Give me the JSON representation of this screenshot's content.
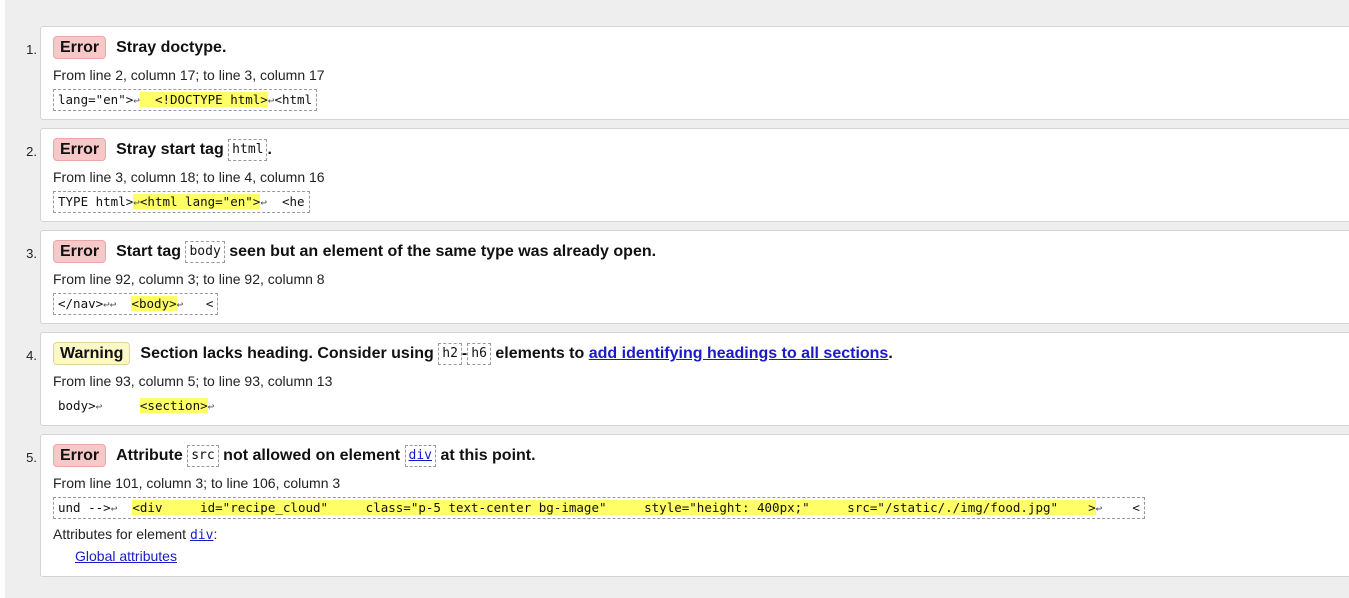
{
  "messages": [
    {
      "number": "1.",
      "type": "Error",
      "text_parts": [
        "Stray doctype."
      ],
      "location": "From line 2, column 17; to line 3, column 17",
      "extract": {
        "before": "lang=\"en\">",
        "hl": "  <!DOCTYPE html>",
        "after": "<html"
      }
    },
    {
      "number": "2.",
      "type": "Error",
      "text_a": "Stray start tag",
      "code": "html",
      "text_b": ".",
      "location": "From line 3, column 18; to line 4, column 16",
      "extract": {
        "before": "TYPE html>",
        "hl": "<html lang=\"en\">",
        "after": "  <he"
      }
    },
    {
      "number": "3.",
      "type": "Error",
      "text_a": "Start tag",
      "code": "body",
      "text_b": "seen but an element of the same type was already open.",
      "location": "From line 92, column 3; to line 92, column 8",
      "extract": {
        "before": "</nav>",
        "hl": "<body>",
        "after": "   <"
      }
    },
    {
      "number": "4.",
      "type": "Warning",
      "text_a": "Section lacks heading. Consider using",
      "code1": "h2",
      "dash": "-",
      "code2": "h6",
      "text_b": "elements to",
      "link": "add identifying headings to all sections",
      "text_c": ".",
      "location": "From line 93, column 5; to line 93, column 13",
      "extract": {
        "before": "body>",
        "hl": "<section>",
        "after": ""
      }
    },
    {
      "number": "5.",
      "type": "Error",
      "text_a": "Attribute",
      "code1": "src",
      "text_b": "not allowed on element",
      "code2": "div",
      "text_c": "at this point.",
      "location": "From line 101, column 3; to line 106, column 3",
      "extract": {
        "before": "und -->",
        "hl": "<div     id=\"recipe_cloud\"     class=\"p-5 text-center bg-image\"     style=\"height: 400px;\"     src=\"/static/./img/food.jpg\"    >",
        "after": "    <"
      },
      "attributes_label": "Attributes for element",
      "attributes_element": "div",
      "attributes_colon": ":",
      "global_link": "Global attributes"
    }
  ]
}
